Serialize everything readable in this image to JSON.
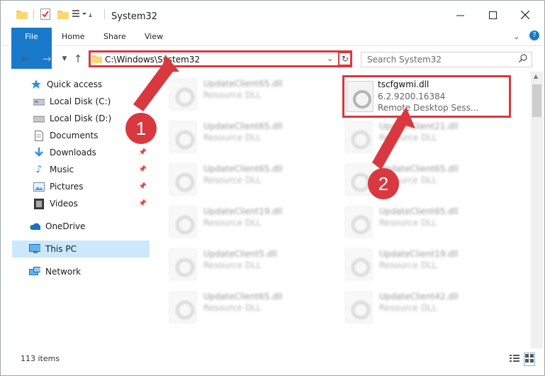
{
  "window": {
    "title": "System32"
  },
  "ribbon": {
    "tabs": [
      "File",
      "Home",
      "Share",
      "View"
    ]
  },
  "address": {
    "path": "C:\\Windows\\System32",
    "search_placeholder": "Search System32"
  },
  "nav": {
    "items": [
      {
        "label": "Quick access",
        "icon": "star-icon",
        "pinned": false
      },
      {
        "label": "Local Disk (C:)",
        "icon": "drive-icon",
        "pinned": true
      },
      {
        "label": "Local Disk (D:)",
        "icon": "drive-icon",
        "pinned": false
      },
      {
        "label": "Documents",
        "icon": "document-icon",
        "pinned": false
      },
      {
        "label": "Downloads",
        "icon": "download-icon",
        "pinned": true
      },
      {
        "label": "Music",
        "icon": "music-icon",
        "pinned": true
      },
      {
        "label": "Pictures",
        "icon": "pictures-icon",
        "pinned": true
      },
      {
        "label": "Videos",
        "icon": "video-icon",
        "pinned": true
      },
      {
        "label": "OneDrive",
        "icon": "cloud-icon",
        "pinned": false
      },
      {
        "label": "This PC",
        "icon": "computer-icon",
        "pinned": false
      },
      {
        "label": "Network",
        "icon": "network-icon",
        "pinned": false
      }
    ]
  },
  "files": {
    "highlighted": {
      "name": "tscfgwmi.dll",
      "version": "6.2.9200.16384",
      "desc": "Remote Desktop Sess..."
    },
    "left": [
      {
        "name": "UpdateClient65.dll",
        "desc": "Resource DLL"
      },
      {
        "name": "UpdateClient65.dll",
        "desc": "Resource DLL"
      },
      {
        "name": "UpdateClient65.dll",
        "desc": "Resource DLL"
      },
      {
        "name": "UpdateClient19.dll",
        "desc": "Resource DLL"
      },
      {
        "name": "UpdateClient5.dll",
        "desc": "Resource DLL"
      },
      {
        "name": "UpdateClient65.dll",
        "desc": "Resource DLL"
      }
    ],
    "right": [
      {
        "name": "UpdateClient21.dll",
        "desc": "Resource DLL"
      },
      {
        "name": "UpdateClient65.dll",
        "desc": "Resource DLL"
      },
      {
        "name": "UpdateClient65.dll",
        "desc": "Resource DLL"
      },
      {
        "name": "UpdateClient19.dll",
        "desc": "Resource DLL"
      },
      {
        "name": "UpdateClient42.dll",
        "desc": "Resource DLL"
      }
    ]
  },
  "status": {
    "count": "113 items"
  },
  "markers": {
    "one": "1",
    "two": "2"
  },
  "colors": {
    "accent": "#1979ca",
    "highlight": "#d9383f",
    "selection": "#cce8ff"
  }
}
